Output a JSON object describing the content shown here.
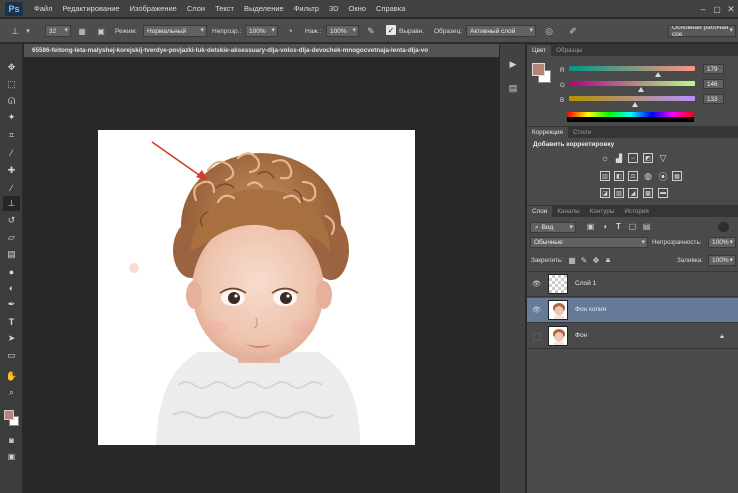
{
  "menubar": {
    "logo": "Ps",
    "items": [
      "Файл",
      "Редактирование",
      "Изображение",
      "Слои",
      "Текст",
      "Выделение",
      "Фильтр",
      "3D",
      "Окно",
      "Справка"
    ]
  },
  "options": {
    "brush_size": "32",
    "mode_label": "Режим:",
    "mode_value": "Нормальный",
    "opacity_label": "Непрозр.:",
    "opacity_value": "100%",
    "pressure_label": "Наж.:",
    "pressure_value": "100%",
    "aligned_label": "Выравн.",
    "sample_label": "Образец:",
    "sample_value": "Активный слой",
    "workspace": "Основная рабочая сре"
  },
  "document": {
    "tab_title": "65586-feitong-leta-malyshej-korejskij-tverdye-povjazki-luk-detskie-aksessuary-dlja-volos-dlja-devochek-mnogocvetnaja-lenta-dlja-vo"
  },
  "colors": {
    "foreground": "#b3857a",
    "background": "#ffffff",
    "selection": "#677b98"
  },
  "color_panel": {
    "tabs": [
      "Цвет",
      "Образцы"
    ],
    "channels": [
      {
        "label": "R",
        "value": "179"
      },
      {
        "label": "G",
        "value": "146"
      },
      {
        "label": "B",
        "value": "133"
      }
    ]
  },
  "adjustments_panel": {
    "tabs": [
      "Коррекция",
      "Стили"
    ],
    "heading": "Добавить корректировку"
  },
  "layers_panel": {
    "tabs": [
      "Слои",
      "Каналы",
      "Контуры",
      "История"
    ],
    "filter": "Вид",
    "blend_mode": "Обычные",
    "opacity_label": "Непрозрачность:",
    "opacity_value": "100%",
    "lock_label": "Закрепить:",
    "fill_label": "Заливка:",
    "fill_value": "100%",
    "layers": [
      {
        "name": "Слой 1",
        "visible": true,
        "selected": false
      },
      {
        "name": "Фон копия",
        "visible": true,
        "selected": true
      },
      {
        "name": "Фон",
        "visible": false,
        "selected": false,
        "locked": true
      }
    ]
  }
}
